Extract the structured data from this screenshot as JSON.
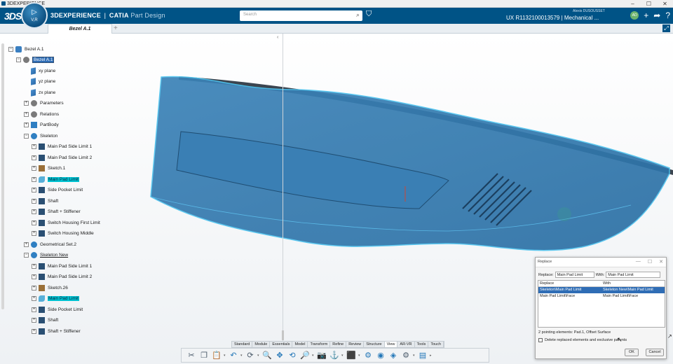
{
  "os_bar": {
    "title": "3DEXPERIENCE",
    "buttons": [
      "–",
      "☐",
      "✕"
    ]
  },
  "header": {
    "brand_main": "3DEXPERIENCE",
    "brand_sep": "|",
    "brand_catia": "CATIA",
    "brand_app": "Part Design",
    "compass_version": "V,R",
    "search_placeholder": "Search",
    "user_name": "Alexis DUSOUSSET",
    "project_line": "UX R1132100013579 | Mechanical ...",
    "avatar_text": "AD"
  },
  "tabs": {
    "active_label": "Bezel A.1",
    "add": "+"
  },
  "tree": {
    "collapse_glyph": "‹",
    "nodes": [
      {
        "label": "Bezel A.1",
        "icon": "part-icon",
        "exp": "−"
      },
      {
        "label": "Bezel A.1",
        "icon": "gear-icon",
        "exp": "−",
        "style": "boxed"
      },
      {
        "label": "xy plane",
        "icon": "plane-icon"
      },
      {
        "label": "yz plane",
        "icon": "plane-icon"
      },
      {
        "label": "zx plane",
        "icon": "plane-icon"
      },
      {
        "label": "Parameters",
        "icon": "parameters-icon",
        "exp": "+"
      },
      {
        "label": "Relations",
        "icon": "relations-icon",
        "exp": "+"
      },
      {
        "label": "PartBody",
        "icon": "body-icon",
        "exp": "+"
      },
      {
        "label": "Skeleton",
        "icon": "geometrical-set-icon",
        "exp": "−"
      },
      {
        "label": "Main Pad Side Limit 1",
        "icon": "surface-icon",
        "exp": "+"
      },
      {
        "label": "Main Pad Side Limit 2",
        "icon": "surface-icon",
        "exp": "+"
      },
      {
        "label": "Sketch.1",
        "icon": "sketch-icon",
        "exp": "+"
      },
      {
        "label": "Main Pad Limit",
        "icon": "curve-icon",
        "exp": "+",
        "style": "sel"
      },
      {
        "label": "Side Pocket Limit",
        "icon": "surface-icon",
        "exp": "+"
      },
      {
        "label": "Shaft",
        "icon": "surface-icon",
        "exp": "+"
      },
      {
        "label": "Shaft + Stiffener",
        "icon": "surface-icon",
        "exp": "+"
      },
      {
        "label": "Switch Housing First Limit",
        "icon": "surface-icon",
        "exp": "+"
      },
      {
        "label": "Switch Housing Middle",
        "icon": "surface-icon",
        "exp": "+"
      },
      {
        "label": "Geometrical Set.2",
        "icon": "geometrical-set-icon",
        "exp": "+"
      },
      {
        "label": "Skeleton New",
        "icon": "geometrical-set-icon",
        "exp": "−",
        "style": "uline"
      },
      {
        "label": "Main Pad Side Limit 1",
        "icon": "surface-icon",
        "exp": "+"
      },
      {
        "label": "Main Pad Side Limit 2",
        "icon": "surface-icon",
        "exp": "+"
      },
      {
        "label": "Sketch.26",
        "icon": "sketch-icon",
        "exp": "+"
      },
      {
        "label": "Main Pad Limit",
        "icon": "curve-icon",
        "exp": "+",
        "style": "sel"
      },
      {
        "label": "Side Pocket Limit",
        "icon": "surface-icon",
        "exp": "+"
      },
      {
        "label": "Shaft",
        "icon": "surface-icon",
        "exp": "+"
      },
      {
        "label": "Shaft + Stiffener",
        "icon": "surface-icon",
        "exp": "+"
      }
    ]
  },
  "replace_dialog": {
    "title": "Replace",
    "replace_label": "Replace:",
    "replace_value": "Main Pad Limit",
    "with_label": "With:",
    "with_value": "Main Pad Limit",
    "col_replace": "Replace",
    "col_with": "With",
    "rows": [
      {
        "replace": "Skeleton\\Main Pad Limit",
        "with": "Skeleton New\\Main Pad Limit"
      },
      {
        "replace": "Main Pad Limit\\Face",
        "with": "Main Pad Limit\\Face"
      }
    ],
    "info": "2 pointing elements: Pad.1, Offset Surface",
    "checkbox_label": "Delete replaced elements and exclusive parents",
    "ok": "OK",
    "cancel": "Cancel"
  },
  "section_tabs": [
    "Standard",
    "Module",
    "Essentials",
    "Model",
    "Transform",
    "Refine",
    "Review",
    "Structure",
    "View",
    "AR-VR",
    "Tools",
    "Touch"
  ],
  "active_section": "View",
  "colors": {
    "header": "#005386",
    "part_fill": "#3d85b8",
    "selection": "#00c2d1"
  }
}
